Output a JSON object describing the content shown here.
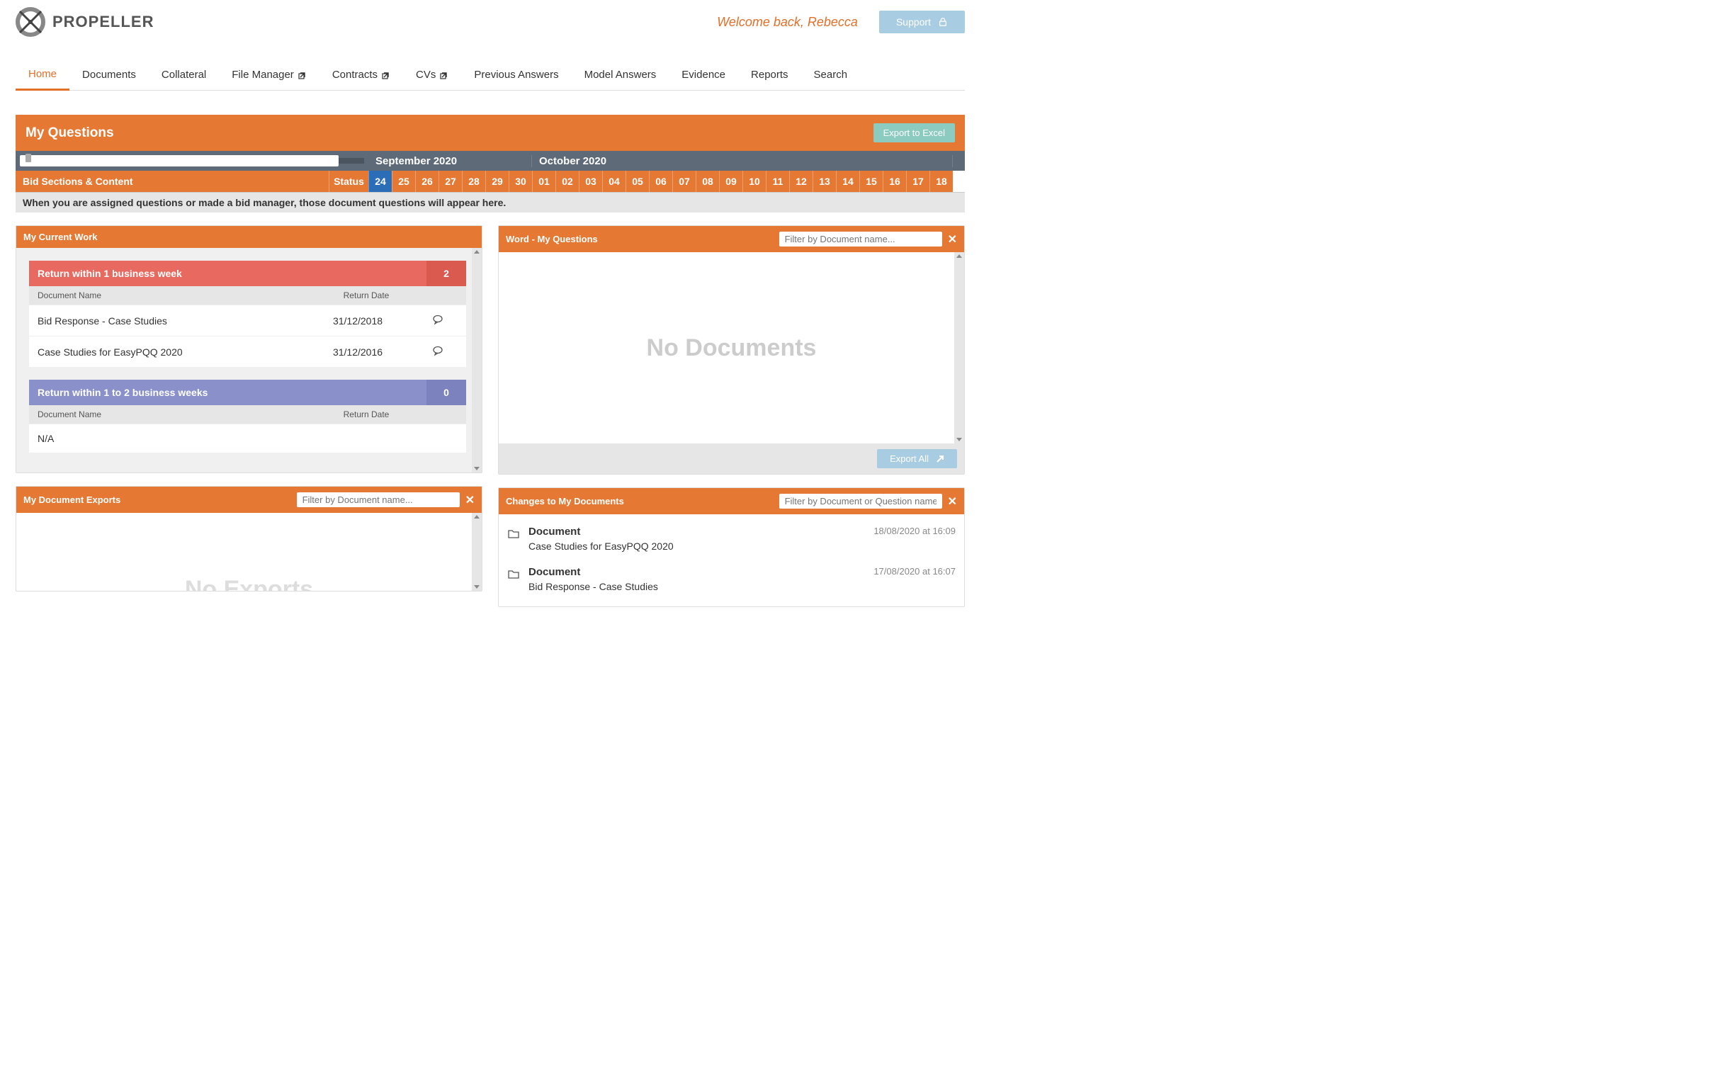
{
  "brand": "PROPELLER",
  "welcome": "Welcome back, Rebecca",
  "support_label": "Support",
  "nav": {
    "items": [
      {
        "label": "Home",
        "active": true,
        "ext": false
      },
      {
        "label": "Documents",
        "active": false,
        "ext": false
      },
      {
        "label": "Collateral",
        "active": false,
        "ext": false
      },
      {
        "label": "File Manager",
        "active": false,
        "ext": true
      },
      {
        "label": "Contracts",
        "active": false,
        "ext": true
      },
      {
        "label": "CVs",
        "active": false,
        "ext": true
      },
      {
        "label": "Previous Answers",
        "active": false,
        "ext": false
      },
      {
        "label": "Model Answers",
        "active": false,
        "ext": false
      },
      {
        "label": "Evidence",
        "active": false,
        "ext": false
      },
      {
        "label": "Reports",
        "active": false,
        "ext": false
      },
      {
        "label": "Search",
        "active": false,
        "ext": false
      }
    ]
  },
  "mq": {
    "title": "My Questions",
    "export_label": "Export to Excel",
    "bid_sections_label": "Bid Sections & Content",
    "status_label": "Status",
    "months": [
      {
        "label": "September 2020",
        "days": [
          "24",
          "25",
          "26",
          "27",
          "28",
          "29",
          "30"
        ],
        "today": "24"
      },
      {
        "label": "October 2020",
        "days": [
          "01",
          "02",
          "03",
          "04",
          "05",
          "06",
          "07",
          "08",
          "09",
          "10",
          "11",
          "12",
          "13",
          "14",
          "15",
          "16",
          "17",
          "18"
        ]
      }
    ],
    "hint": "When you are assigned questions or made a bid manager, those document questions will appear here."
  },
  "current_work": {
    "title": "My Current Work",
    "col_name": "Document Name",
    "col_date": "Return Date",
    "groups": [
      {
        "label": "Return within 1 business week",
        "count": "2",
        "tone": "red",
        "rows": [
          {
            "name": "Bid Response - Case Studies",
            "date": "31/12/2018",
            "comment": true
          },
          {
            "name": "Case Studies for EasyPQQ 2020",
            "date": "31/12/2016",
            "comment": true
          }
        ]
      },
      {
        "label": "Return within 1 to 2 business weeks",
        "count": "0",
        "tone": "blue",
        "rows": [
          {
            "name": "N/A",
            "date": "",
            "comment": false
          }
        ]
      }
    ]
  },
  "word_panel": {
    "title": "Word - My Questions",
    "filter_placeholder": "Filter by Document name...",
    "empty_text": "No Documents",
    "export_all_label": "Export All"
  },
  "exports_panel": {
    "title": "My Document Exports",
    "filter_placeholder": "Filter by Document name...",
    "ghost": "No Exports"
  },
  "changes_panel": {
    "title": "Changes to My Documents",
    "filter_placeholder": "Filter by Document or Question name...",
    "items": [
      {
        "type": "Document",
        "name": "Case Studies for EasyPQQ 2020",
        "time": "18/08/2020 at 16:09"
      },
      {
        "type": "Document",
        "name": "Bid Response - Case Studies",
        "time": "17/08/2020 at 16:07"
      }
    ]
  }
}
